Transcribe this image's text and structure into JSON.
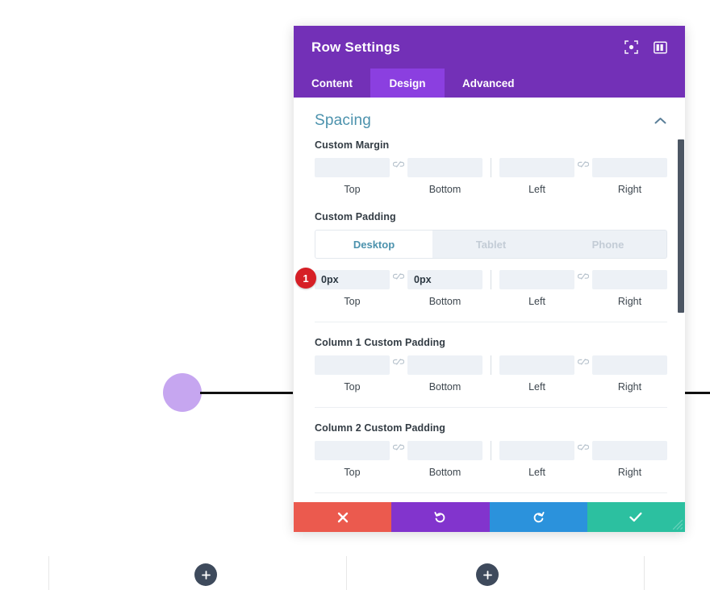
{
  "modal": {
    "title": "Row Settings",
    "header_icons": [
      {
        "name": "focus-icon",
        "label": "Focus"
      },
      {
        "name": "layout-columns-icon",
        "label": "Layout"
      }
    ],
    "tabs": [
      {
        "label": "Content",
        "active": false
      },
      {
        "label": "Design",
        "active": true
      },
      {
        "label": "Advanced",
        "active": false
      }
    ],
    "section": {
      "title": "Spacing",
      "collapsed": false
    },
    "groups": [
      {
        "label": "Custom Margin",
        "has_device_tabs": false,
        "badge": null,
        "fields": [
          {
            "caption": "Top",
            "value": "",
            "placeholder": ""
          },
          {
            "caption": "Bottom",
            "value": "",
            "placeholder": ""
          },
          {
            "caption": "Left",
            "value": "",
            "placeholder": ""
          },
          {
            "caption": "Right",
            "value": "",
            "placeholder": ""
          }
        ]
      },
      {
        "label": "Custom Padding",
        "has_device_tabs": true,
        "device_tabs": [
          {
            "label": "Desktop",
            "active": true
          },
          {
            "label": "Tablet",
            "active": false
          },
          {
            "label": "Phone",
            "active": false
          }
        ],
        "badge": "1",
        "fields": [
          {
            "caption": "Top",
            "value": "0px",
            "placeholder": ""
          },
          {
            "caption": "Bottom",
            "value": "0px",
            "placeholder": ""
          },
          {
            "caption": "Left",
            "value": "",
            "placeholder": ""
          },
          {
            "caption": "Right",
            "value": "",
            "placeholder": ""
          }
        ]
      },
      {
        "label": "Column 1 Custom Padding",
        "has_device_tabs": false,
        "badge": null,
        "fields": [
          {
            "caption": "Top",
            "value": "",
            "placeholder": ""
          },
          {
            "caption": "Bottom",
            "value": "",
            "placeholder": ""
          },
          {
            "caption": "Left",
            "value": "",
            "placeholder": ""
          },
          {
            "caption": "Right",
            "value": "",
            "placeholder": ""
          }
        ]
      },
      {
        "label": "Column 2 Custom Padding",
        "has_device_tabs": false,
        "badge": null,
        "fields": [
          {
            "caption": "Top",
            "value": "",
            "placeholder": ""
          },
          {
            "caption": "Bottom",
            "value": "",
            "placeholder": ""
          },
          {
            "caption": "Left",
            "value": "",
            "placeholder": ""
          },
          {
            "caption": "Right",
            "value": "",
            "placeholder": ""
          }
        ]
      }
    ],
    "footer": [
      {
        "name": "cancel-button",
        "icon": "close-icon"
      },
      {
        "name": "undo-button",
        "icon": "undo-icon"
      },
      {
        "name": "redo-button",
        "icon": "redo-icon"
      },
      {
        "name": "save-button",
        "icon": "check-icon"
      }
    ]
  },
  "canvas": {
    "add_buttons": [
      {
        "name": "add-module-button-1",
        "label": "+"
      },
      {
        "name": "add-module-button-2",
        "label": "+"
      }
    ]
  },
  "colors": {
    "header_purple": "#7330b7",
    "tab_active_purple": "#8b3fe0",
    "section_title_blue": "#4c92ad",
    "input_bg": "#edf1f6",
    "badge_red": "#d61f26",
    "cancel_red": "#eb5a4e",
    "undo_purple": "#8234cd",
    "redo_blue": "#2b92dc",
    "save_green": "#2cc0a0",
    "node_circle_purple": "#c6a6f0",
    "add_button_dark": "#3e4a5c"
  }
}
